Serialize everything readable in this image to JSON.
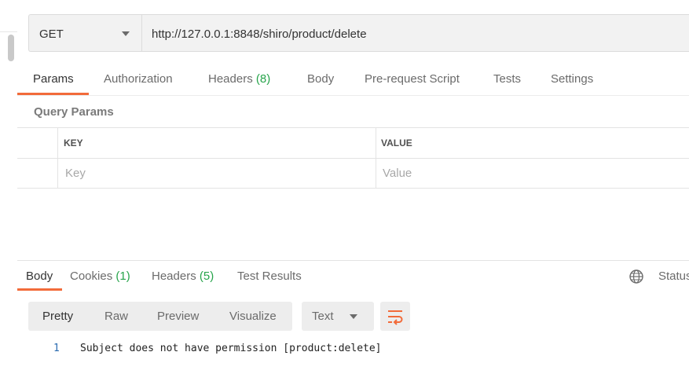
{
  "request": {
    "method": "GET",
    "url": "http://127.0.0.1:8848/shiro/product/delete"
  },
  "request_tabs": [
    {
      "label": "Params",
      "active": true
    },
    {
      "label": "Authorization"
    },
    {
      "label": "Headers",
      "count": "(8)"
    },
    {
      "label": "Body"
    },
    {
      "label": "Pre-request Script"
    },
    {
      "label": "Tests"
    },
    {
      "label": "Settings"
    }
  ],
  "query_params": {
    "title": "Query Params",
    "columns": [
      "KEY",
      "VALUE"
    ],
    "key_placeholder": "Key",
    "value_placeholder": "Value"
  },
  "response_tabs": [
    {
      "label": "Body",
      "active": true
    },
    {
      "label": "Cookies",
      "count": "(1)"
    },
    {
      "label": "Headers",
      "count": "(5)"
    },
    {
      "label": "Test Results"
    }
  ],
  "status_label": "Status",
  "view_modes": [
    "Pretty",
    "Raw",
    "Preview",
    "Visualize"
  ],
  "format": "Text",
  "response_body": {
    "lines": [
      {
        "number": "1",
        "text": "Subject does not have permission [product:delete]"
      }
    ]
  },
  "icons": {
    "method_dropdown": "chevron-down-icon",
    "format_dropdown": "chevron-down-icon",
    "wrap": "wrap-lines-icon",
    "environment": "globe-icon"
  },
  "colors": {
    "accent": "#f26b3a",
    "count": "#27a44b"
  }
}
